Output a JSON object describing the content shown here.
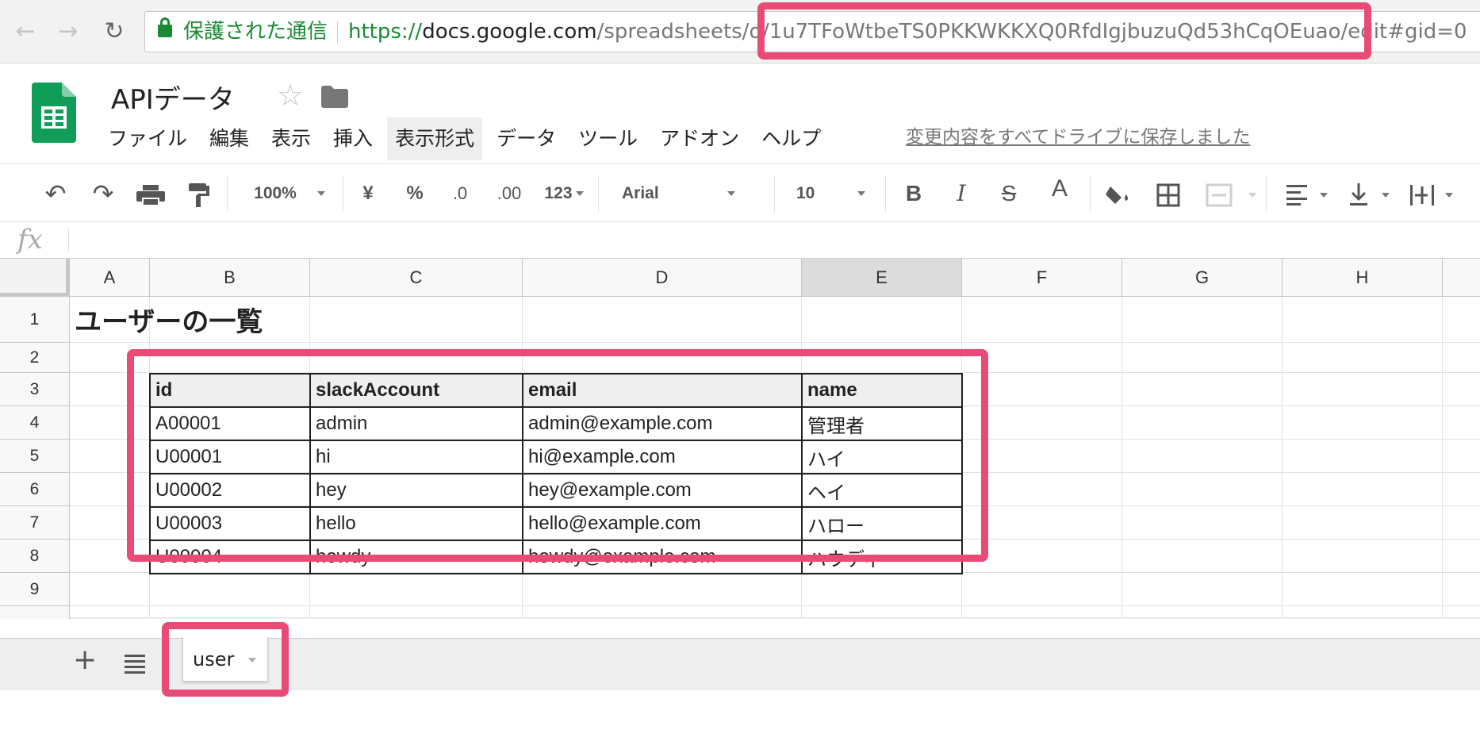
{
  "browser": {
    "secure_label": "保護された通信",
    "url_scheme": "https://",
    "url_host": "docs.google.com",
    "url_path": "/spreadsheets/d/1u7TFoWtbeTS0PKKWKKXQ0RfdIgjbuzuQd53hCqOEuao/edit#gid=0"
  },
  "doc": {
    "title": "APIデータ"
  },
  "menu": [
    "ファイル",
    "編集",
    "表示",
    "挿入",
    "表示形式",
    "データ",
    "ツール",
    "アドオン",
    "ヘルプ"
  ],
  "save_status": "変更内容をすべてドライブに保存しました",
  "toolbar": {
    "zoom": "100%",
    "currency": "¥",
    "percent": "%",
    "dec_decrease": ".0",
    "dec_increase": ".00",
    "more_formats": "123",
    "font": "Arial",
    "font_size": "10",
    "bold": "B",
    "italic": "I",
    "strike": "S",
    "text_color": "A"
  },
  "formula_icon": "fx",
  "columns": [
    "A",
    "B",
    "C",
    "D",
    "E",
    "F",
    "G",
    "H"
  ],
  "rows": [
    "1",
    "2",
    "3",
    "4",
    "5",
    "6",
    "7",
    "8",
    "9"
  ],
  "sheet_title": "ユーザーの一覧",
  "table": {
    "headers": [
      "id",
      "slackAccount",
      "email",
      "name"
    ],
    "rows": [
      [
        "A00001",
        "admin",
        "admin@example.com",
        "管理者"
      ],
      [
        "U00001",
        "hi",
        "hi@example.com",
        "ハイ"
      ],
      [
        "U00002",
        "hey",
        "hey@example.com",
        "ヘイ"
      ],
      [
        "U00003",
        "hello",
        "hello@example.com",
        "ハロー"
      ],
      [
        "U00004",
        "howdy",
        "howdy@example.com",
        "ハウディ"
      ]
    ]
  },
  "sheet_tab": "user",
  "colors": {
    "highlight": "#e94b76",
    "secure": "#1a8a34",
    "sheets_green": "#0f9d58"
  }
}
